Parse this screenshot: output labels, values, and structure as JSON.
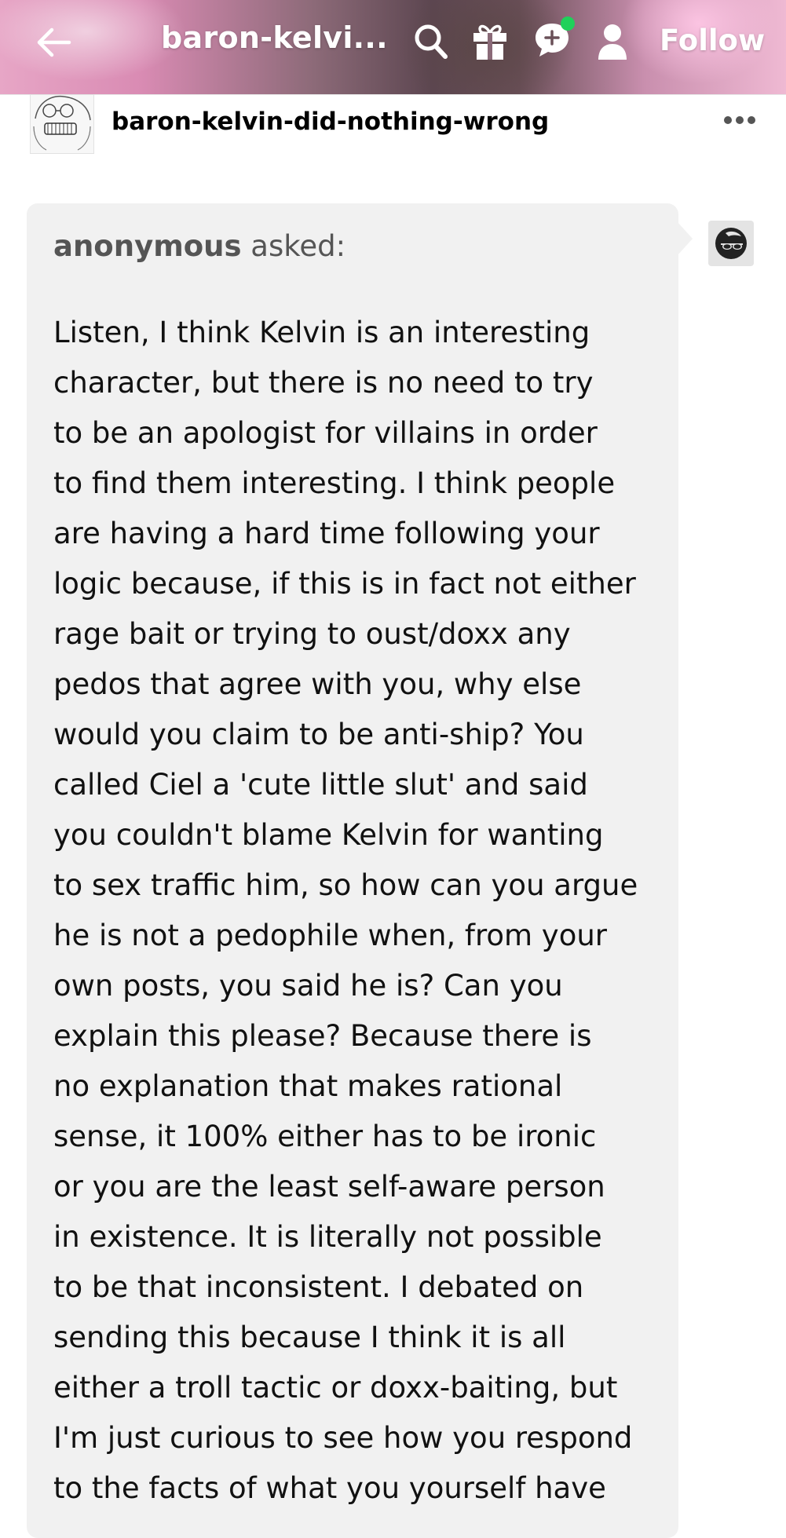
{
  "header": {
    "title": "baron-kelvi...",
    "follow_label": "Follow",
    "icons": [
      "back-arrow-icon",
      "search-icon",
      "gift-icon",
      "chat-icon",
      "user-icon"
    ],
    "notification_dot_color": "#1fd15a"
  },
  "post": {
    "blog_name": "baron-kelvin-did-nothing-wrong",
    "more_icon": "more-dots-icon",
    "ask": {
      "asker": "anonymous",
      "asked_suffix": " asked:",
      "question_lines": [
        "Listen, I think Kelvin is an interesting",
        "character, but there is no need to try",
        "to be an apologist for villains in order",
        "to find them interesting. I think people",
        "are having a hard time following your",
        "logic because, if this is in fact not either",
        "rage bait or trying to oust/doxx any",
        "pedos that agree with you, why else",
        "would you claim to be anti-ship? You",
        "called Ciel a 'cute little slut' and said",
        "you couldn't blame Kelvin for wanting",
        "to sex traffic him, so how can you argue",
        "he is not a pedophile when, from your",
        "own posts, you said he is? Can you",
        "explain this please? Because there is",
        "no explanation that makes rational",
        "sense, it 100% either has to be ironic",
        "or you are the least self-aware person",
        "in existence. It is literally not possible",
        "to be that inconsistent. I debated on",
        "sending this because I think it is all",
        "either a troll tactic or doxx-baiting, but",
        "I'm just curious to see how you respond",
        "to the facts of what you yourself have"
      ]
    }
  }
}
